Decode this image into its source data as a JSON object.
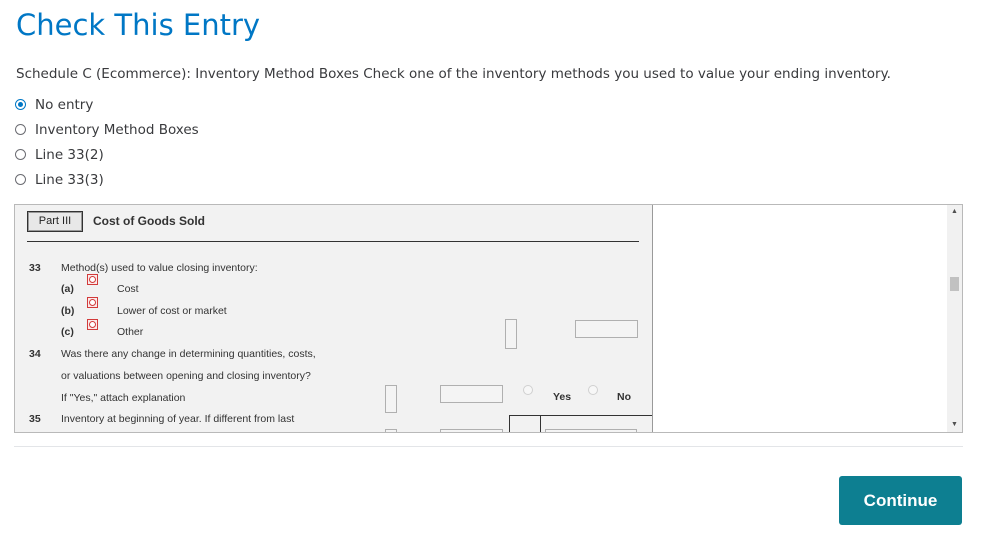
{
  "page": {
    "title": "Check This Entry",
    "instruction": "Schedule C (Ecommerce): Inventory Method Boxes Check one of the inventory methods you used to value your ending inventory."
  },
  "options": [
    {
      "label": "No entry",
      "selected": true
    },
    {
      "label": "Inventory Method Boxes",
      "selected": false
    },
    {
      "label": "Line 33(2)",
      "selected": false
    },
    {
      "label": "Line 33(3)",
      "selected": false
    }
  ],
  "form": {
    "part_label": "Part III",
    "part_title": "Cost of Goods Sold",
    "line33_num": "33",
    "line33_text": "Method(s) used to value closing inventory:",
    "a_label": "(a)",
    "a_text": "Cost",
    "b_label": "(b)",
    "b_text": "Lower of cost or market",
    "c_label": "(c)",
    "c_text": "Other",
    "line34_num": "34",
    "line34_text1": "Was there any change in determining quantities, costs,",
    "line34_text2": "or valuations between opening and closing inventory?",
    "line34_text3": "If \"Yes,\" attach explanation",
    "yes_label": "Yes",
    "no_label": "No",
    "line35_num": "35",
    "line35_text": "Inventory at beginning of year. If different from last"
  },
  "scrollbar": {
    "up_icon": "▲",
    "down_icon": "▼"
  },
  "footer": {
    "continue_label": "Continue"
  },
  "colors": {
    "title": "#0077c5",
    "continue_button": "#0d7f91",
    "radio_selected": "#0077c5",
    "form_checkbox_border": "#d23a3a"
  }
}
